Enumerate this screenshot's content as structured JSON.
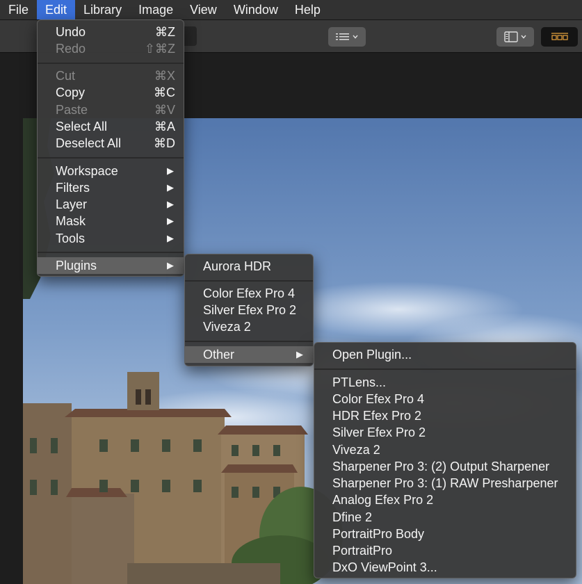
{
  "menubar": {
    "items": [
      "File",
      "Edit",
      "Library",
      "Image",
      "View",
      "Window",
      "Help"
    ],
    "active": "Edit"
  },
  "edit_menu": {
    "undo": {
      "label": "Undo",
      "shortcut": "⌘Z"
    },
    "redo": {
      "label": "Redo",
      "shortcut": "⇧⌘Z"
    },
    "cut": {
      "label": "Cut",
      "shortcut": "⌘X"
    },
    "copy": {
      "label": "Copy",
      "shortcut": "⌘C"
    },
    "paste": {
      "label": "Paste",
      "shortcut": "⌘V"
    },
    "select_all": {
      "label": "Select All",
      "shortcut": "⌘A"
    },
    "deselect_all": {
      "label": "Deselect All",
      "shortcut": "⌘D"
    },
    "workspace": {
      "label": "Workspace"
    },
    "filters": {
      "label": "Filters"
    },
    "layer": {
      "label": "Layer"
    },
    "mask": {
      "label": "Mask"
    },
    "tools": {
      "label": "Tools"
    },
    "plugins": {
      "label": "Plugins"
    },
    "submenu_arrow": "▶"
  },
  "plugins_menu": {
    "aurora_hdr": "Aurora HDR",
    "color_efex": "Color Efex Pro 4",
    "silver_efex": "Silver Efex Pro 2",
    "viveza": "Viveza 2",
    "other": "Other"
  },
  "other_menu": {
    "open_plugin": "Open Plugin...",
    "items": [
      "PTLens...",
      "Color Efex Pro 4",
      "HDR Efex Pro 2",
      "Silver Efex Pro 2",
      "Viveza 2",
      "Sharpener Pro 3: (2) Output Sharpener",
      "Sharpener Pro 3: (1) RAW Presharpener",
      "Analog Efex Pro 2",
      "Dfine 2",
      "PortraitPro Body",
      "PortraitPro",
      "DxO ViewPoint 3..."
    ]
  },
  "colors": {
    "menubar_active": "#3a6fd8",
    "menu_bg": "#3a3a3a",
    "menu_highlight": "#616161",
    "filmstrip_icon": "#e8a33d"
  },
  "icons": {
    "toolbar": [
      "list-view-icon",
      "chevron-down-icon",
      "sidebar-layout-icon",
      "filmstrip-icon"
    ]
  }
}
